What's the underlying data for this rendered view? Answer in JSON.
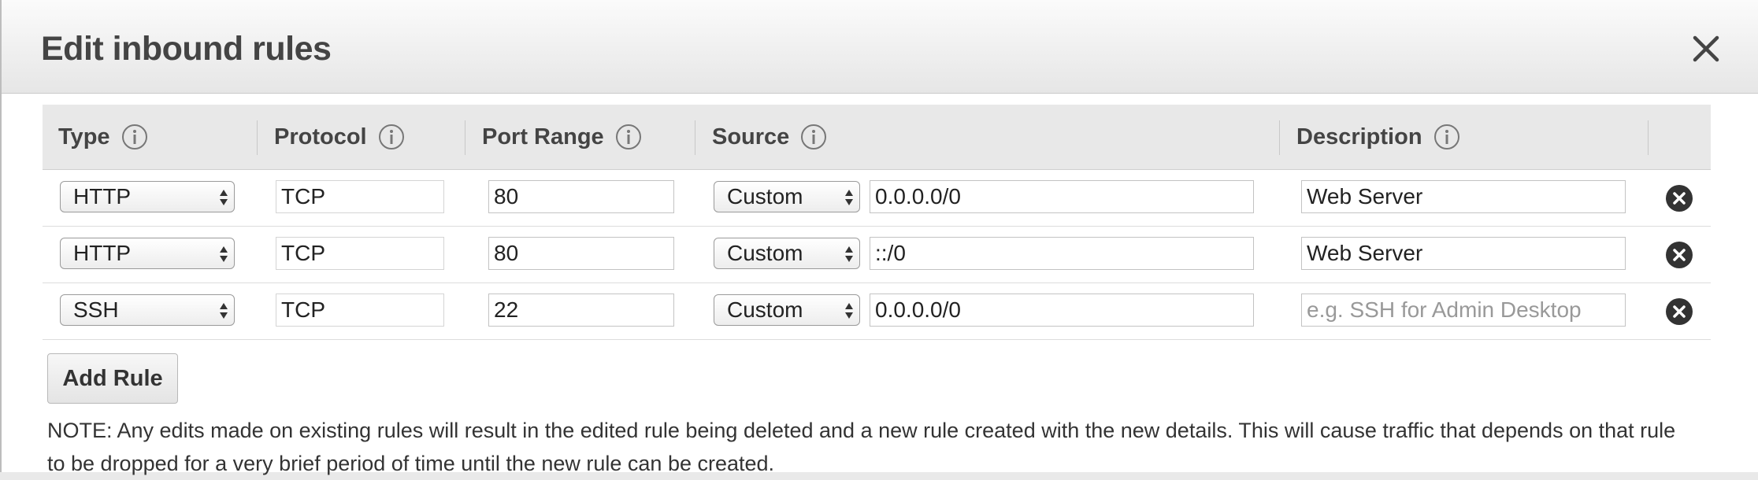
{
  "dialog": {
    "title": "Edit inbound rules"
  },
  "table": {
    "headers": {
      "type": "Type",
      "protocol": "Protocol",
      "port_range": "Port Range",
      "source": "Source",
      "description": "Description"
    },
    "rows": [
      {
        "type": "HTTP",
        "protocol": "TCP",
        "port_range": "80",
        "source_type": "Custom",
        "source": "0.0.0.0/0",
        "description": "Web Server",
        "description_placeholder": ""
      },
      {
        "type": "HTTP",
        "protocol": "TCP",
        "port_range": "80",
        "source_type": "Custom",
        "source": "::/0",
        "description": "Web Server",
        "description_placeholder": ""
      },
      {
        "type": "SSH",
        "protocol": "TCP",
        "port_range": "22",
        "source_type": "Custom",
        "source": "0.0.0.0/0",
        "description": "",
        "description_placeholder": "e.g. SSH for Admin Desktop"
      }
    ]
  },
  "actions": {
    "add_rule_label": "Add Rule"
  },
  "note": "NOTE: Any edits made on existing rules will result in the edited rule being deleted and a new rule created with the new details. This will cause traffic that depends on that rule to be dropped for a very brief period of time until the new rule can be created.",
  "icons": {
    "close": "close-icon",
    "info": "info-icon",
    "delete": "remove-circle-icon",
    "select_arrows": "select-arrows-icon"
  },
  "colors": {
    "header_gradient_top": "#fbfbfb",
    "header_gradient_bottom": "#e6e6e6",
    "table_header_bg": "#e8e8e8",
    "delete_icon": "#333333",
    "placeholder_text": "#999999"
  }
}
